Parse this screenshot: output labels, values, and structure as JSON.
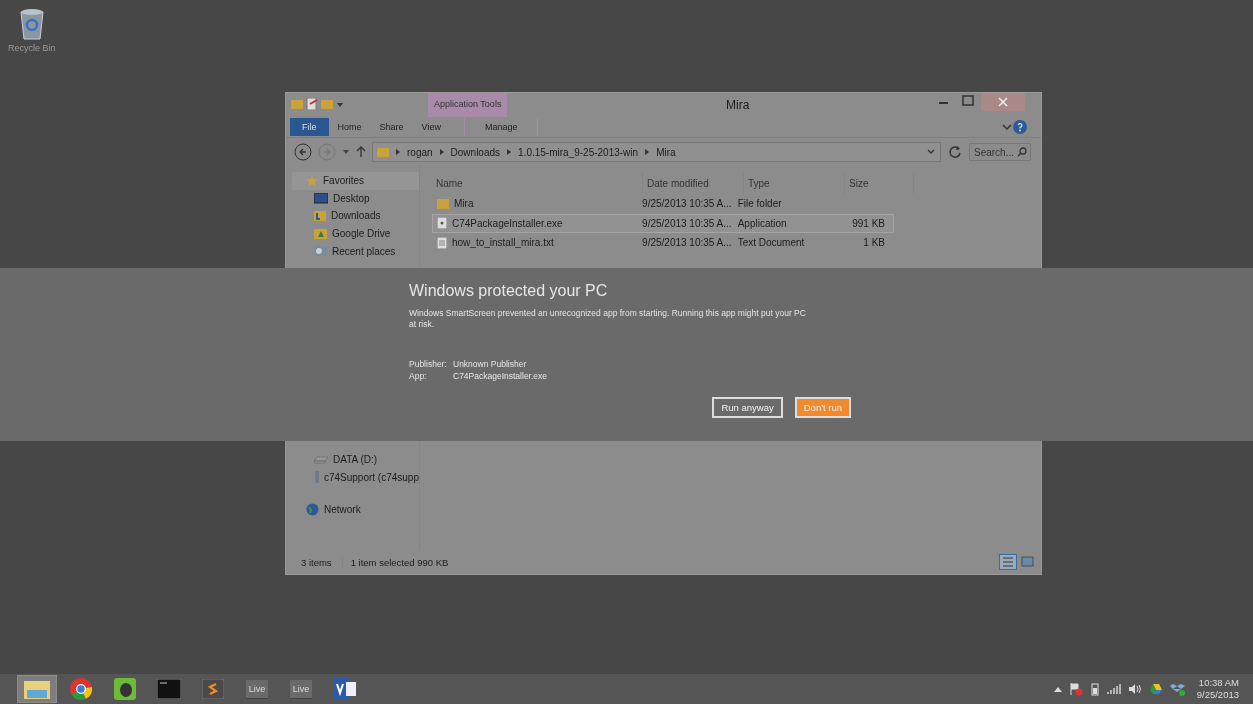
{
  "desktop": {
    "icons": [
      {
        "label": "Recycle Bin"
      }
    ]
  },
  "window": {
    "title": "Mira",
    "contextual_tab_group": "Application Tools",
    "ribbon_tabs": [
      {
        "label": "File",
        "kind": "file",
        "selected": false
      },
      {
        "label": "Home",
        "kind": "tab",
        "selected": false
      },
      {
        "label": "Share",
        "kind": "tab",
        "selected": false
      },
      {
        "label": "View",
        "kind": "tab",
        "selected": false
      },
      {
        "label": "Manage",
        "kind": "contextual",
        "selected": false
      }
    ],
    "breadcrumbs": [
      "rogan",
      "Downloads",
      "1.0.15-mira_9-25-2013-win",
      "Mira"
    ],
    "search": {
      "placeholder": "Search..."
    },
    "sidebar": {
      "sections": [
        {
          "header": "Favorites",
          "items": [
            {
              "label": "Desktop",
              "kind": "desktop"
            },
            {
              "label": "Downloads",
              "kind": "downloads"
            },
            {
              "label": "Google Drive",
              "kind": "drive"
            },
            {
              "label": "Recent places",
              "kind": "recent"
            }
          ]
        },
        {
          "items": [
            {
              "label": "DATA (D:)",
              "kind": "disk"
            },
            {
              "label": "c74Support (c74supp",
              "kind": "share"
            }
          ]
        },
        {
          "header": "Network"
        }
      ]
    },
    "columns": [
      "Name",
      "Date modified",
      "Type",
      "Size"
    ],
    "files": [
      {
        "name": "Mira",
        "kind": "folder",
        "date": "9/25/2013 10:35 A...",
        "type": "File folder",
        "selected": false
      },
      {
        "name": "C74PackageInstaller.exe",
        "kind": "exe",
        "date": "9/25/2013 10:35 A...",
        "type": "Application",
        "size": "991 KB",
        "selected": true
      },
      {
        "name": "how_to_install_mira.txt",
        "kind": "txt",
        "date": "9/25/2013 10:35 A...",
        "type": "Text Document",
        "size": "1 KB",
        "selected": false
      }
    ],
    "status_bar": {
      "count": "3 items",
      "selection": "1 item selected  990 KB"
    }
  },
  "smartscreen": {
    "title": "Windows protected your PC",
    "message": "Windows SmartScreen prevented an unrecognized app from starting. Running this app might put your PC at risk.",
    "details": [
      {
        "label": "Publisher:",
        "value": "Unknown Publisher"
      },
      {
        "label": "App:",
        "value": "C74PackageInstaller.exe"
      }
    ],
    "buttons": [
      {
        "label": "Run anyway",
        "kind": "secondary"
      },
      {
        "label": "Don't run",
        "kind": "primary"
      }
    ]
  },
  "taskbar": {
    "items": [
      {
        "kind": "explorer",
        "selected": true
      },
      {
        "kind": "chrome",
        "selected": false
      },
      {
        "kind": "evernote",
        "selected": false
      },
      {
        "kind": "terminal",
        "selected": false
      },
      {
        "kind": "sublime",
        "selected": false
      },
      {
        "kind": "live",
        "label": "Live",
        "selected": false
      },
      {
        "kind": "live",
        "label": "Live",
        "selected": false
      },
      {
        "kind": "visio",
        "selected": false
      }
    ],
    "tray": {
      "time": "10:38 AM",
      "date": "9/25/2013"
    }
  }
}
